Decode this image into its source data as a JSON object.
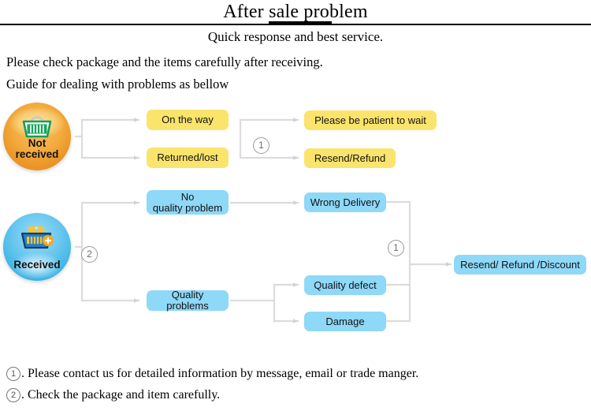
{
  "header": {
    "title": "After sale problem",
    "subtitle": "Quick response and best service.",
    "intro_line_1": "Please check package and the items carefully after receiving.",
    "intro_line_2": "Guide for dealing with problems as bellow"
  },
  "colors": {
    "yellow_box": "#fae46c",
    "blue_box": "#8ed8f8",
    "badge_orange": "#f3a93c",
    "badge_blue": "#3fb4e6",
    "connector": "#d9d9d9",
    "rule": "#000000"
  },
  "diagram": {
    "badges": [
      {
        "id": "not-received",
        "label_line_1": "Not",
        "label_line_2": "received",
        "icon": "shopping-basket-icon"
      },
      {
        "id": "received",
        "label_line_1": "Received",
        "label_line_2": "",
        "icon": "filled-basket-icon"
      }
    ],
    "boxes": {
      "on_the_way": "On the way",
      "returned_lost": "Returned/lost",
      "please_wait": "Please be patient to wait",
      "resend_refund": "Resend/Refund",
      "no_quality_problem_line1": "No",
      "no_quality_problem_line2": "quality problem",
      "quality_problems": "Quality problems",
      "wrong_delivery": "Wrong Delivery",
      "quality_defect": "Quality defect",
      "damage": "Damage",
      "resend_refund_discount": "Resend/ Refund /Discount"
    },
    "markers": {
      "one": "1",
      "two": "2"
    }
  },
  "notes": [
    {
      "mark": "1",
      "text": ". Please contact us for detailed information by message, email or trade manger."
    },
    {
      "mark": "2",
      "text": ". Check the package and item carefully."
    }
  ]
}
